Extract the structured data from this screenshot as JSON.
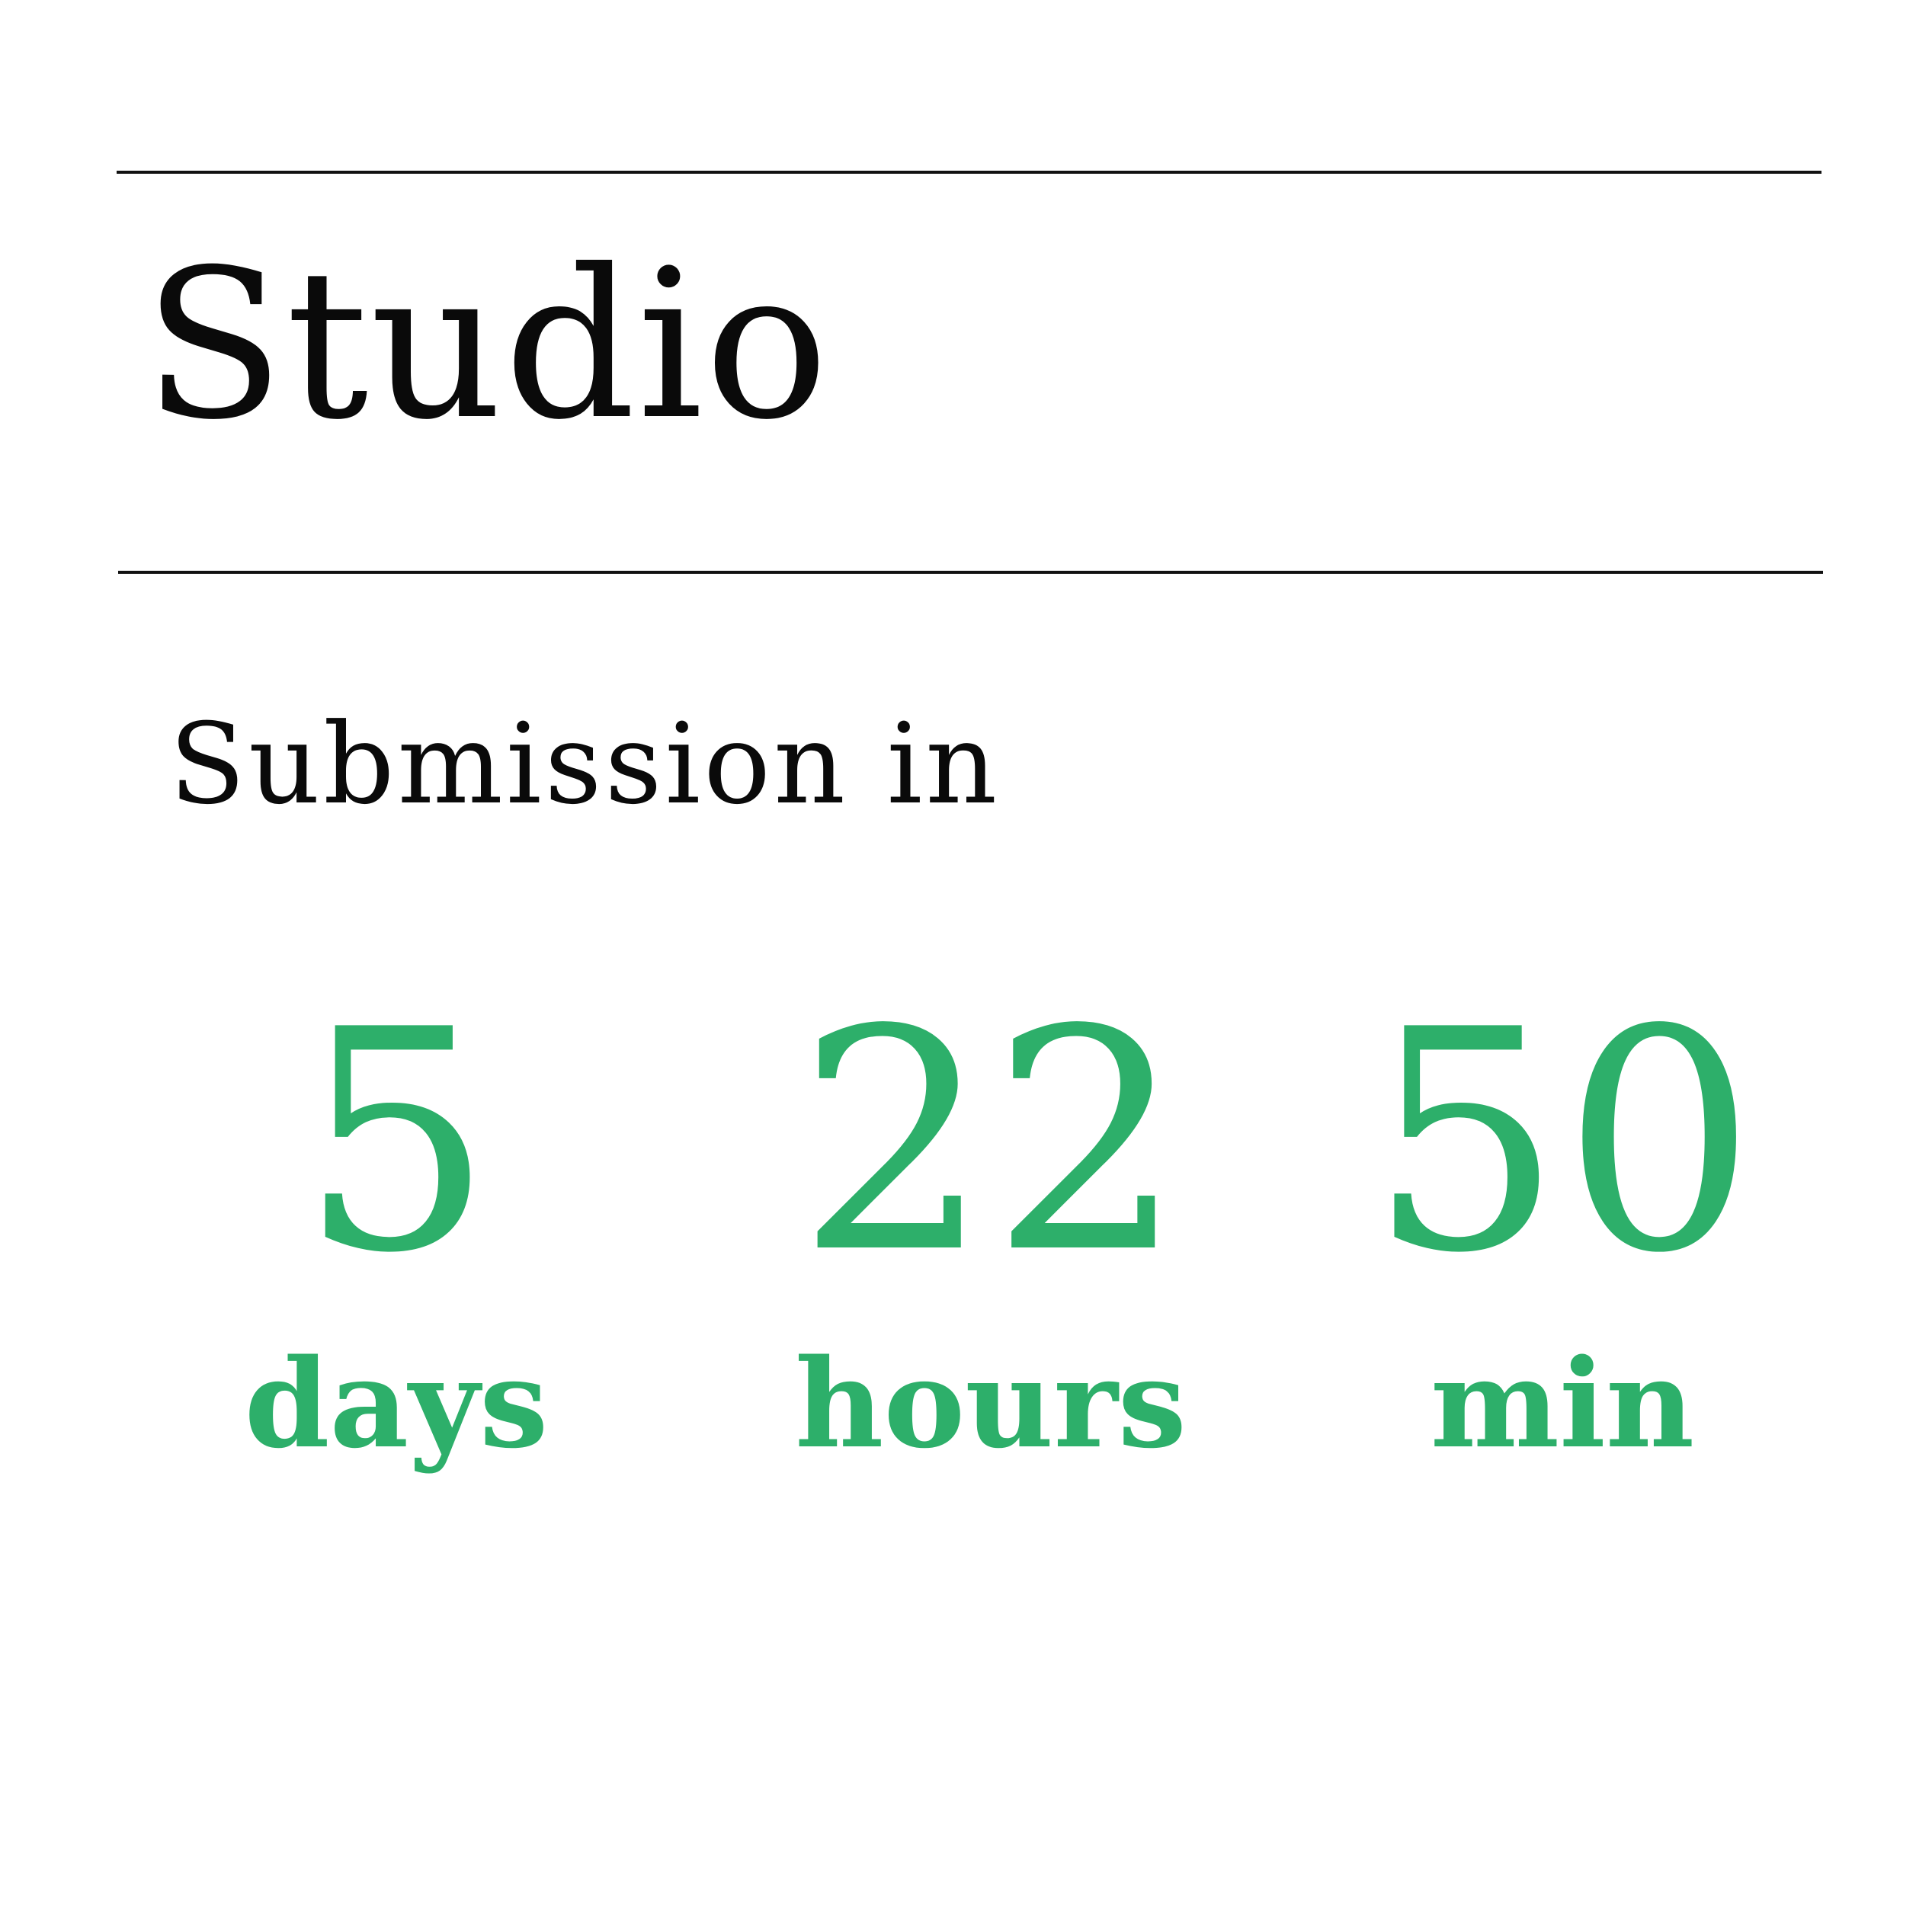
{
  "header": {
    "title": "Studio",
    "subtitle": "Submission in"
  },
  "countdown": {
    "days": {
      "value": "5",
      "label": "days"
    },
    "hours": {
      "value": "22",
      "label": "hours"
    },
    "minutes": {
      "value": "50",
      "label": "min"
    }
  },
  "colors": {
    "accent": "#2daf6a",
    "text": "#0a0a0a",
    "rule": "#111111",
    "background": "#ffffff"
  }
}
